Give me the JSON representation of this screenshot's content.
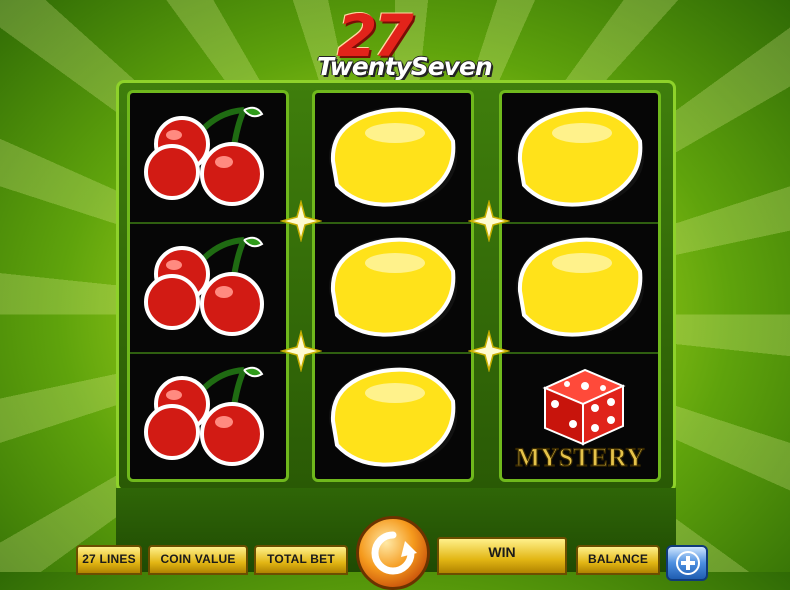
{
  "game": {
    "logo_number": "27",
    "logo_text": "TwentySeven"
  },
  "reels": [
    [
      "cherry",
      "cherry",
      "cherry"
    ],
    [
      "lemon",
      "lemon",
      "lemon"
    ],
    [
      "lemon",
      "lemon",
      "mystery-dice"
    ]
  ],
  "mystery_label": "MYSTERY",
  "bottom_bar": {
    "lines_label": "27 LINES",
    "coin_value_label": "COIN VALUE",
    "total_bet_label": "TOTAL BET",
    "win_label": "WIN",
    "balance_label": "BALANCE"
  },
  "colors": {
    "background": "#7fc21a",
    "frame": "#3f7e0c",
    "panel_gold": "#e2b614",
    "spin_orange": "#f59a1d",
    "plus_blue": "#4c8fe0"
  },
  "icons": {
    "spin": "spin-arrow-icon",
    "plus": "plus-icon",
    "payline_marker": "star-marker-icon"
  }
}
